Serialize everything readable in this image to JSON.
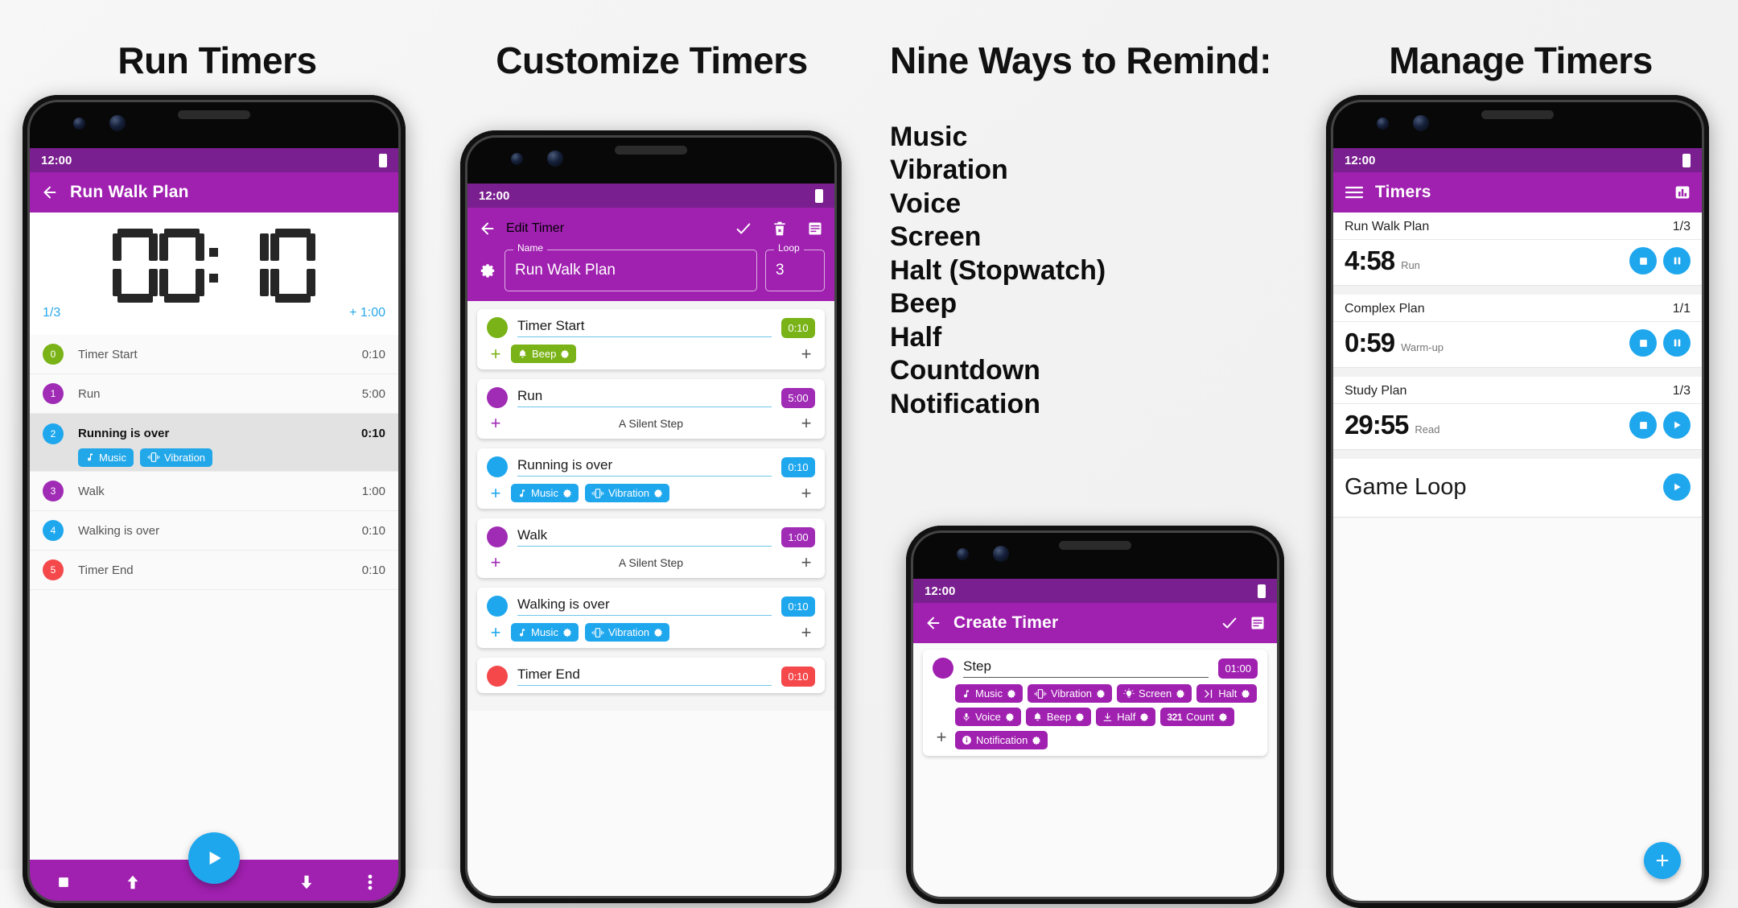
{
  "panels": [
    {
      "headline": "Run Timers"
    },
    {
      "headline": "Customize Timers"
    },
    {
      "headline": "Nine Ways to Remind:"
    },
    {
      "headline": "Manage Timers"
    }
  ],
  "ways": [
    "Music",
    "Vibration",
    "Voice",
    "Screen",
    "Halt (Stopwatch)",
    "Beep",
    "Half",
    "Countdown",
    "Notification"
  ],
  "run_screen": {
    "status_time": "12:00",
    "app_title": "Run Walk Plan",
    "back_icon": "arrow-left-icon",
    "display_time": "00:10",
    "display_digits": [
      "0",
      "0",
      ":",
      "1",
      "0"
    ],
    "loop_counter": "1/3",
    "add_time": "+ 1:00",
    "steps": [
      {
        "index": "0",
        "name": "Timer Start",
        "time": "0:10",
        "color": "#7ab317",
        "active": false,
        "chips": []
      },
      {
        "index": "1",
        "name": "Run",
        "time": "5:00",
        "color": "#a02bb5",
        "active": false,
        "chips": []
      },
      {
        "index": "2",
        "name": "Running is over",
        "time": "0:10",
        "color": "#1fa7ee",
        "active": true,
        "chips": [
          {
            "label": "Music",
            "icon": "music-note-icon"
          },
          {
            "label": "Vibration",
            "icon": "vibration-icon"
          }
        ]
      },
      {
        "index": "3",
        "name": "Walk",
        "time": "1:00",
        "color": "#a02bb5",
        "active": false,
        "chips": []
      },
      {
        "index": "4",
        "name": "Walking is over",
        "time": "0:10",
        "color": "#1fa7ee",
        "active": false,
        "chips": []
      },
      {
        "index": "5",
        "name": "Timer End",
        "time": "0:10",
        "color": "#f4484b",
        "active": false,
        "chips": []
      }
    ],
    "toolbar": [
      {
        "name": "stop-button",
        "icon": "stop-square-icon"
      },
      {
        "name": "move-up-button",
        "icon": "arrow-up-icon"
      },
      {
        "name": "play-button",
        "icon": "play-icon"
      },
      {
        "name": "move-down-button",
        "icon": "arrow-down-icon"
      },
      {
        "name": "overflow-button",
        "icon": "more-vertical-icon"
      }
    ]
  },
  "edit_screen": {
    "status_time": "12:00",
    "app_title": "Edit Timer",
    "actions": [
      "check-icon",
      "delete-icon",
      "notes-icon"
    ],
    "settings_icon": "gear-icon",
    "name_label": "Name",
    "name_value": "Run Walk Plan",
    "loop_label": "Loop",
    "loop_value": "3",
    "cards": [
      {
        "name": "Timer Start",
        "time": "0:10",
        "color": "#7ab317",
        "silent": "",
        "chips": [
          {
            "label": "Beep",
            "icon": "bell-icon"
          }
        ]
      },
      {
        "name": "Run",
        "time": "5:00",
        "color": "#a02bb5",
        "silent": "A Silent Step",
        "chips": []
      },
      {
        "name": "Running is over",
        "time": "0:10",
        "color": "#1fa7ee",
        "silent": "",
        "chips": [
          {
            "label": "Music",
            "icon": "music-note-icon"
          },
          {
            "label": "Vibration",
            "icon": "vibration-icon"
          }
        ]
      },
      {
        "name": "Walk",
        "time": "1:00",
        "color": "#a02bb5",
        "silent": "A Silent Step",
        "chips": []
      },
      {
        "name": "Walking is over",
        "time": "0:10",
        "color": "#1fa7ee",
        "silent": "",
        "chips": [
          {
            "label": "Music",
            "icon": "music-note-icon"
          },
          {
            "label": "Vibration",
            "icon": "vibration-icon"
          }
        ]
      },
      {
        "name": "Timer End",
        "time": "0:10",
        "color": "#f4484b",
        "silent": "",
        "chips": []
      }
    ]
  },
  "create_screen": {
    "status_time": "12:00",
    "app_title": "Create Timer",
    "actions": [
      "check-icon",
      "notes-icon"
    ],
    "step_name": "Step",
    "step_time": "01:00",
    "step_color": "#a020b0",
    "reminders": [
      {
        "label": "Music",
        "icon": "music-note-icon"
      },
      {
        "label": "Vibration",
        "icon": "vibration-icon"
      },
      {
        "label": "Screen",
        "icon": "lightbulb-icon"
      },
      {
        "label": "Halt",
        "icon": "halt-icon"
      },
      {
        "label": "Voice",
        "icon": "microphone-icon"
      },
      {
        "label": "Beep",
        "icon": "bell-icon"
      },
      {
        "label": "Half",
        "icon": "half-icon"
      },
      {
        "label": "Count",
        "icon": "count-321-icon"
      },
      {
        "label": "Notification",
        "icon": "info-icon"
      }
    ]
  },
  "manage_screen": {
    "status_time": "12:00",
    "app_title": "Timers",
    "menu_icon": "hamburger-icon",
    "stats_icon": "bar-chart-icon",
    "add_icon": "plus-icon",
    "timers": [
      {
        "name": "Run Walk Plan",
        "loop": "1/3",
        "time": "4:58",
        "step": "Run",
        "buttons": [
          "stop-square-icon",
          "pause-icon"
        ]
      },
      {
        "name": "Complex Plan",
        "loop": "1/1",
        "time": "0:59",
        "step": "Warm-up",
        "buttons": [
          "stop-square-icon",
          "pause-icon"
        ]
      },
      {
        "name": "Study Plan",
        "loop": "1/3",
        "time": "29:55",
        "step": "Read",
        "buttons": [
          "stop-square-icon",
          "play-icon"
        ]
      }
    ],
    "idle_timer": {
      "name": "Game Loop",
      "buttons": [
        "play-icon"
      ]
    }
  },
  "colors": {
    "primary": "#a020b0",
    "primary_dark": "#7a1f8f",
    "accent": "#1fa7ee",
    "green": "#7ab317",
    "red": "#f4484b"
  }
}
